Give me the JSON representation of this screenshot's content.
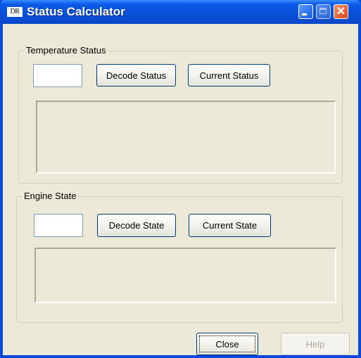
{
  "window": {
    "app_icon_text": "DR",
    "title": "Status Calculator"
  },
  "temperature": {
    "legend": "Temperature Status",
    "input_value": "",
    "decode_label": "Decode Status",
    "current_label": "Current Status",
    "output_text": ""
  },
  "engine": {
    "legend": "Engine State",
    "input_value": "",
    "decode_label": "Decode State",
    "current_label": "Current State",
    "output_text": ""
  },
  "footer": {
    "close_label": "Close",
    "help_label": "Help"
  }
}
